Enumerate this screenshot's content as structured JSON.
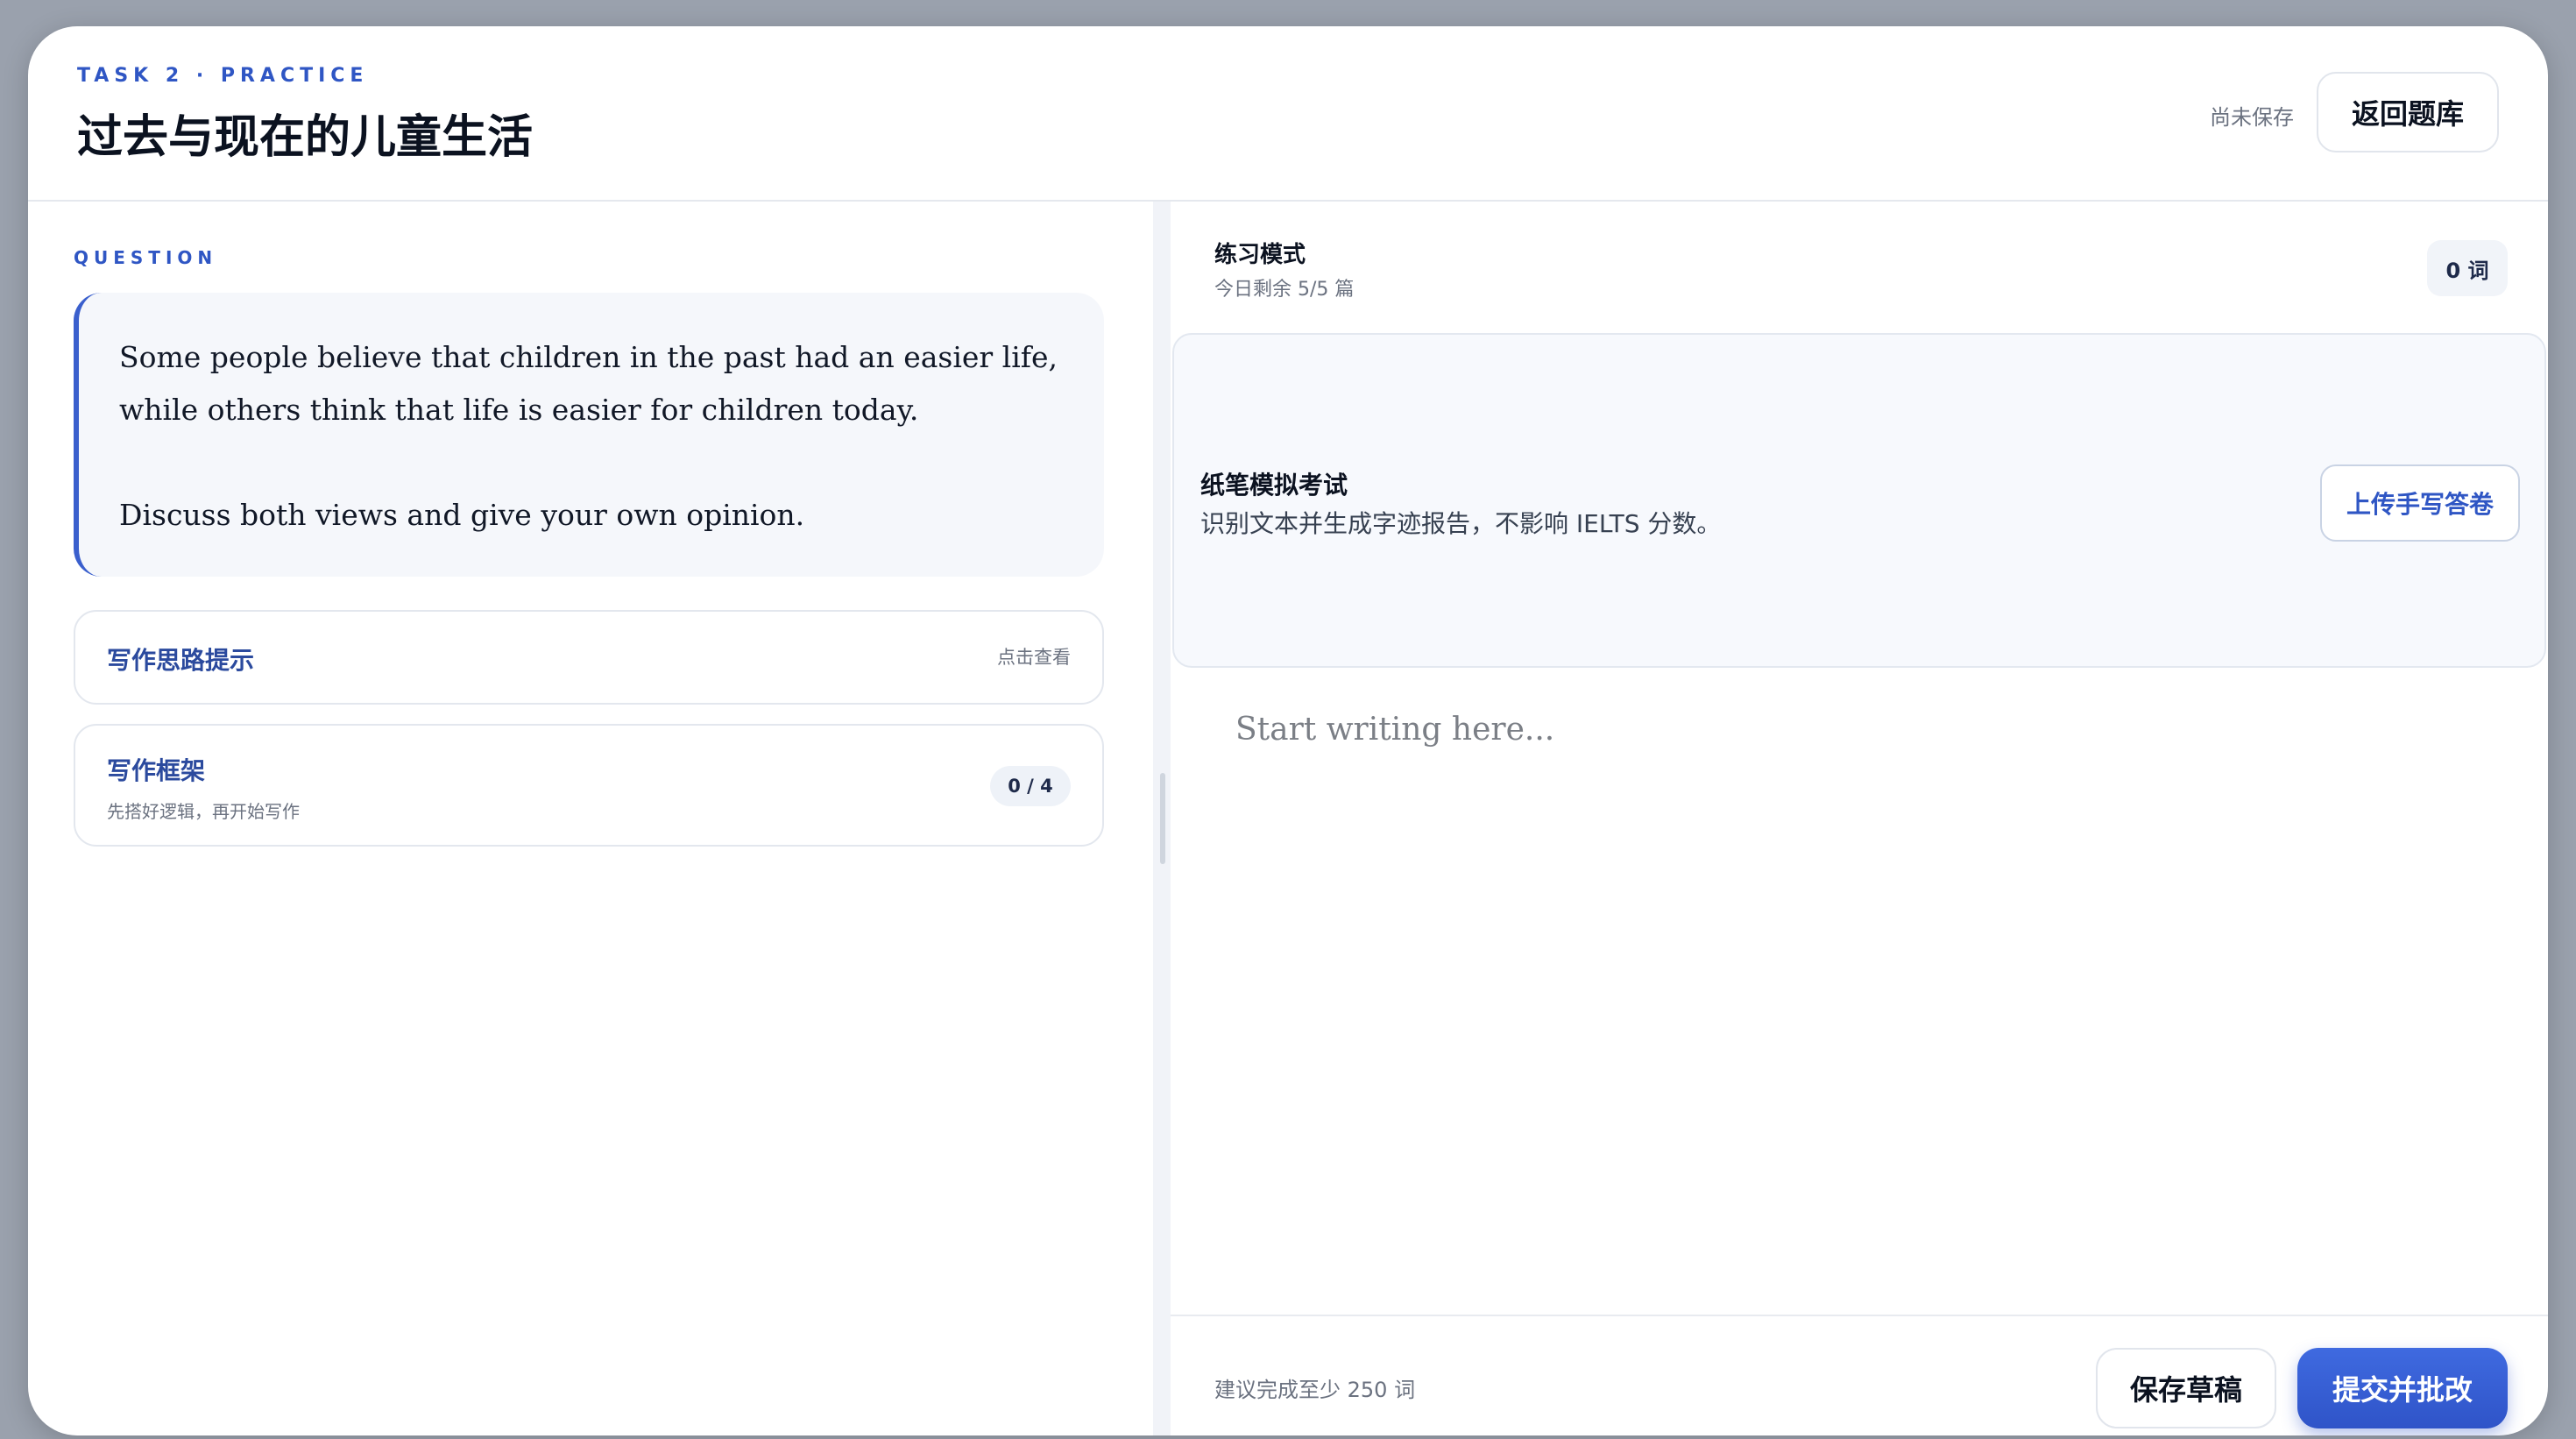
{
  "header": {
    "eyebrow": "TASK 2 · PRACTICE",
    "title": "过去与现在的儿童生活",
    "save_status": "尚未保存",
    "back_label": "返回题库"
  },
  "question": {
    "section_label": "QUESTION",
    "paragraphs": [
      "Some people believe that children in the past had an easier life, while others think that life is easier for children today.",
      "Discuss both views and give your own opinion."
    ]
  },
  "hints": {
    "title": "写作思路提示",
    "action": "点击查看"
  },
  "framework": {
    "title": "写作框架",
    "subtitle": "先搭好逻辑，再开始写作",
    "progress": "0 / 4"
  },
  "mode": {
    "label": "练习模式",
    "remaining": "今日剩余 5/5 篇",
    "word_count": "0 词"
  },
  "paper_exam": {
    "title": "纸笔模拟考试",
    "description": "识别文本并生成字迹报告，不影响 IELTS 分数。",
    "upload_label": "上传手写答卷"
  },
  "editor": {
    "placeholder": "Start writing here...",
    "value": ""
  },
  "footer": {
    "hint": "建议完成至少 250 词",
    "draft_label": "保存草稿",
    "submit_label": "提交并批改"
  },
  "colors": {
    "accent": "#2f56c4",
    "submit": "#3a5fd6",
    "question_border": "#3a5fcd"
  }
}
